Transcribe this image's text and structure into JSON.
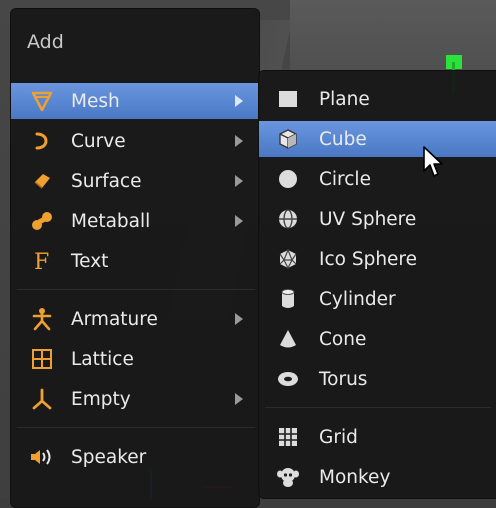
{
  "add_menu": {
    "title": "Add",
    "items": [
      {
        "id": "mesh",
        "label": "Mesh",
        "icon": "mesh-icon",
        "submenu": true,
        "active": true
      },
      {
        "id": "curve",
        "label": "Curve",
        "icon": "curve-icon",
        "submenu": true
      },
      {
        "id": "surface",
        "label": "Surface",
        "icon": "surface-icon",
        "submenu": true
      },
      {
        "id": "metaball",
        "label": "Metaball",
        "icon": "metaball-icon",
        "submenu": true
      },
      {
        "id": "text",
        "label": "Text",
        "icon": "text-icon",
        "submenu": false
      },
      {
        "id": "armature",
        "label": "Armature",
        "icon": "armature-icon",
        "submenu": true
      },
      {
        "id": "lattice",
        "label": "Lattice",
        "icon": "lattice-icon",
        "submenu": false
      },
      {
        "id": "empty",
        "label": "Empty",
        "icon": "empty-icon",
        "submenu": true
      },
      {
        "id": "speaker",
        "label": "Speaker",
        "icon": "speaker-icon",
        "submenu": false
      }
    ]
  },
  "mesh_menu": {
    "items": [
      {
        "id": "plane",
        "label": "Plane",
        "icon": "plane-icon"
      },
      {
        "id": "cube",
        "label": "Cube",
        "icon": "cube-icon",
        "active": true
      },
      {
        "id": "circle",
        "label": "Circle",
        "icon": "circle-icon"
      },
      {
        "id": "uv_sphere",
        "label": "UV Sphere",
        "icon": "uv-sphere-icon"
      },
      {
        "id": "ico_sphere",
        "label": "Ico Sphere",
        "icon": "ico-sphere-icon"
      },
      {
        "id": "cylinder",
        "label": "Cylinder",
        "icon": "cylinder-icon"
      },
      {
        "id": "cone",
        "label": "Cone",
        "icon": "cone-icon"
      },
      {
        "id": "torus",
        "label": "Torus",
        "icon": "torus-icon"
      },
      {
        "id": "grid",
        "label": "Grid",
        "icon": "grid-icon"
      },
      {
        "id": "monkey",
        "label": "Monkey",
        "icon": "monkey-icon"
      }
    ]
  },
  "colors": {
    "menu_bg": "#171717",
    "highlight": "#5a86d2",
    "icon_orange": "#f0a030",
    "icon_gray": "#d8d8d8"
  }
}
